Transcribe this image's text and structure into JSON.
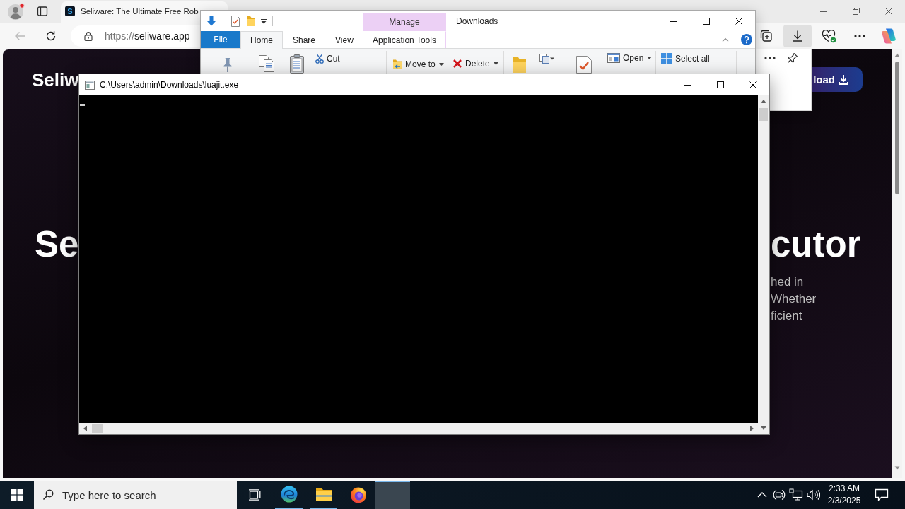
{
  "browser": {
    "tabs": [
      {
        "favicon_letter": "S",
        "title": "Seliware: The Ultimate Free Rob",
        "selected": true
      }
    ],
    "navigation": {
      "back_disabled": true
    },
    "address": {
      "scheme": "https://",
      "host": "seliware.app"
    },
    "downloads_flyout_open": true,
    "page": {
      "logo": "Seliw",
      "download_button": "load",
      "hero_heading_start": "Se",
      "hero_heading_end": "cutor",
      "hero_paragraph_lines": [
        "hed in",
        "Whether",
        "ficient"
      ]
    }
  },
  "explorer": {
    "title": "Downloads",
    "file_tab": "File",
    "tabs": [
      {
        "label": "Home",
        "selected": true
      },
      {
        "label": "Share",
        "selected": false
      },
      {
        "label": "View",
        "selected": false
      },
      {
        "label": "Application Tools",
        "group": "Manage",
        "selected": false
      }
    ],
    "commands": [
      {
        "label": "Cut",
        "dropdown": false
      },
      {
        "label": "Move to",
        "dropdown": true
      },
      {
        "label": "Delete",
        "dropdown": true
      },
      {
        "label": "Open",
        "dropdown": true
      },
      {
        "label": "Select all",
        "dropdown": false
      }
    ]
  },
  "console": {
    "title": "C:\\Users\\admin\\Downloads\\luajit.exe"
  },
  "taskbar": {
    "search_placeholder": "Type here to search",
    "apps": [
      {
        "kind": "browser",
        "running": true,
        "active": false
      },
      {
        "kind": "folder",
        "running": true,
        "active": false
      },
      {
        "kind": "globe",
        "running": false,
        "active": false
      },
      {
        "kind": "blank",
        "running": true,
        "active": true
      }
    ],
    "clock": {
      "time": "2:33 AM",
      "date": "2/3/2025"
    }
  }
}
